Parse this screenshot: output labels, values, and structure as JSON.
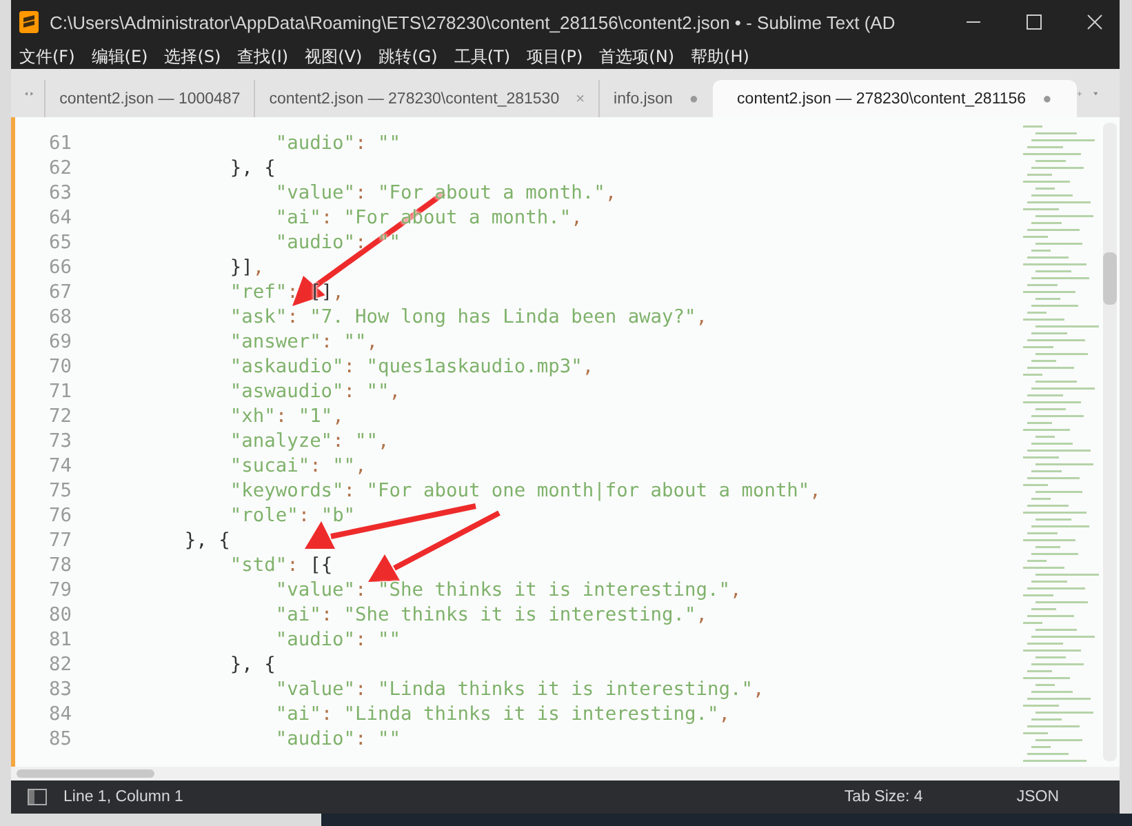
{
  "window": {
    "title": "C:\\Users\\Administrator\\AppData\\Roaming\\ETS\\278230\\content_281156\\content2.json • - Sublime Text (AD"
  },
  "menu": [
    "文件(F)",
    "编辑(E)",
    "选择(S)",
    "查找(I)",
    "视图(V)",
    "跳转(G)",
    "工具(T)",
    "项目(P)",
    "首选项(N)",
    "帮助(H)"
  ],
  "tabs": [
    {
      "label": "content2.json — 1000487",
      "selected": false
    },
    {
      "label": "content2.json — 278230\\content_281530",
      "selected": false,
      "marker": "×"
    },
    {
      "label": "info.json",
      "selected": false,
      "marker": "●"
    },
    {
      "label": "content2.json — 278230\\content_281156",
      "selected": true,
      "marker": "●"
    }
  ],
  "editor": {
    "lines": [
      {
        "number": "61",
        "segments": [
          {
            "kind": "string",
            "text": "                \"audio\""
          },
          {
            "kind": "punct",
            "text": ": "
          },
          {
            "kind": "string",
            "text": "\"\""
          }
        ]
      },
      {
        "number": "62",
        "segments": [
          {
            "kind": "brace",
            "text": "            }, {"
          }
        ]
      },
      {
        "number": "63",
        "segments": [
          {
            "kind": "string",
            "text": "                \"value\""
          },
          {
            "kind": "punct",
            "text": ": "
          },
          {
            "kind": "string",
            "text": "\"For about a month.\""
          },
          {
            "kind": "punct",
            "text": ","
          }
        ]
      },
      {
        "number": "64",
        "segments": [
          {
            "kind": "string",
            "text": "                \"ai\""
          },
          {
            "kind": "punct",
            "text": ": "
          },
          {
            "kind": "string",
            "text": "\"For about a month.\""
          },
          {
            "kind": "punct",
            "text": ","
          }
        ]
      },
      {
        "number": "65",
        "segments": [
          {
            "kind": "string",
            "text": "                \"audio\""
          },
          {
            "kind": "punct",
            "text": ": "
          },
          {
            "kind": "string",
            "text": "\"\""
          }
        ]
      },
      {
        "number": "66",
        "segments": [
          {
            "kind": "brace",
            "text": "            }]"
          },
          {
            "kind": "punct",
            "text": ","
          }
        ]
      },
      {
        "number": "67",
        "segments": [
          {
            "kind": "string",
            "text": "            \"ref\""
          },
          {
            "kind": "punct",
            "text": ": "
          },
          {
            "kind": "brace",
            "text": "[]"
          },
          {
            "kind": "punct",
            "text": ","
          }
        ]
      },
      {
        "number": "68",
        "segments": [
          {
            "kind": "string",
            "text": "            \"ask\""
          },
          {
            "kind": "punct",
            "text": ": "
          },
          {
            "kind": "string",
            "text": "\"7. How long has Linda been away?\""
          },
          {
            "kind": "punct",
            "text": ","
          }
        ]
      },
      {
        "number": "69",
        "segments": [
          {
            "kind": "string",
            "text": "            \"answer\""
          },
          {
            "kind": "punct",
            "text": ": "
          },
          {
            "kind": "string",
            "text": "\"\""
          },
          {
            "kind": "punct",
            "text": ","
          }
        ]
      },
      {
        "number": "70",
        "segments": [
          {
            "kind": "string",
            "text": "            \"askaudio\""
          },
          {
            "kind": "punct",
            "text": ": "
          },
          {
            "kind": "string",
            "text": "\"ques1askaudio.mp3\""
          },
          {
            "kind": "punct",
            "text": ","
          }
        ]
      },
      {
        "number": "71",
        "segments": [
          {
            "kind": "string",
            "text": "            \"aswaudio\""
          },
          {
            "kind": "punct",
            "text": ": "
          },
          {
            "kind": "string",
            "text": "\"\""
          },
          {
            "kind": "punct",
            "text": ","
          }
        ]
      },
      {
        "number": "72",
        "segments": [
          {
            "kind": "string",
            "text": "            \"xh\""
          },
          {
            "kind": "punct",
            "text": ": "
          },
          {
            "kind": "string",
            "text": "\"1\""
          },
          {
            "kind": "punct",
            "text": ","
          }
        ]
      },
      {
        "number": "73",
        "segments": [
          {
            "kind": "string",
            "text": "            \"analyze\""
          },
          {
            "kind": "punct",
            "text": ": "
          },
          {
            "kind": "string",
            "text": "\"\""
          },
          {
            "kind": "punct",
            "text": ","
          }
        ]
      },
      {
        "number": "74",
        "segments": [
          {
            "kind": "string",
            "text": "            \"sucai\""
          },
          {
            "kind": "punct",
            "text": ": "
          },
          {
            "kind": "string",
            "text": "\"\""
          },
          {
            "kind": "punct",
            "text": ","
          }
        ]
      },
      {
        "number": "75",
        "segments": [
          {
            "kind": "string",
            "text": "            \"keywords\""
          },
          {
            "kind": "punct",
            "text": ": "
          },
          {
            "kind": "string",
            "text": "\"For about one month|for about a month\""
          },
          {
            "kind": "punct",
            "text": ","
          }
        ]
      },
      {
        "number": "76",
        "segments": [
          {
            "kind": "string",
            "text": "            \"role\""
          },
          {
            "kind": "punct",
            "text": ": "
          },
          {
            "kind": "string",
            "text": "\"b\""
          }
        ]
      },
      {
        "number": "77",
        "segments": [
          {
            "kind": "brace",
            "text": "        }, {"
          }
        ]
      },
      {
        "number": "78",
        "segments": [
          {
            "kind": "string",
            "text": "            \"std\""
          },
          {
            "kind": "punct",
            "text": ": "
          },
          {
            "kind": "brace",
            "text": "[{"
          }
        ]
      },
      {
        "number": "79",
        "segments": [
          {
            "kind": "string",
            "text": "                \"value\""
          },
          {
            "kind": "punct",
            "text": ": "
          },
          {
            "kind": "string",
            "text": "\"She thinks it is interesting.\""
          },
          {
            "kind": "punct",
            "text": ","
          }
        ]
      },
      {
        "number": "80",
        "segments": [
          {
            "kind": "string",
            "text": "                \"ai\""
          },
          {
            "kind": "punct",
            "text": ": "
          },
          {
            "kind": "string",
            "text": "\"She thinks it is interesting.\""
          },
          {
            "kind": "punct",
            "text": ","
          }
        ]
      },
      {
        "number": "81",
        "segments": [
          {
            "kind": "string",
            "text": "                \"audio\""
          },
          {
            "kind": "punct",
            "text": ": "
          },
          {
            "kind": "string",
            "text": "\"\""
          }
        ]
      },
      {
        "number": "82",
        "segments": [
          {
            "kind": "brace",
            "text": "            }, {"
          }
        ]
      },
      {
        "number": "83",
        "segments": [
          {
            "kind": "string",
            "text": "                \"value\""
          },
          {
            "kind": "punct",
            "text": ": "
          },
          {
            "kind": "string",
            "text": "\"Linda thinks it is interesting.\""
          },
          {
            "kind": "punct",
            "text": ","
          }
        ]
      },
      {
        "number": "84",
        "segments": [
          {
            "kind": "string",
            "text": "                \"ai\""
          },
          {
            "kind": "punct",
            "text": ": "
          },
          {
            "kind": "string",
            "text": "\"Linda thinks it is interesting.\""
          },
          {
            "kind": "punct",
            "text": ","
          }
        ]
      },
      {
        "number": "85",
        "segments": [
          {
            "kind": "string",
            "text": "                \"audio\""
          },
          {
            "kind": "punct",
            "text": ": "
          },
          {
            "kind": "string",
            "text": "\"\""
          }
        ]
      }
    ]
  },
  "status_bar": {
    "position": "Line 1, Column 1",
    "tab_size": "Tab Size: 4",
    "syntax": "JSON"
  }
}
